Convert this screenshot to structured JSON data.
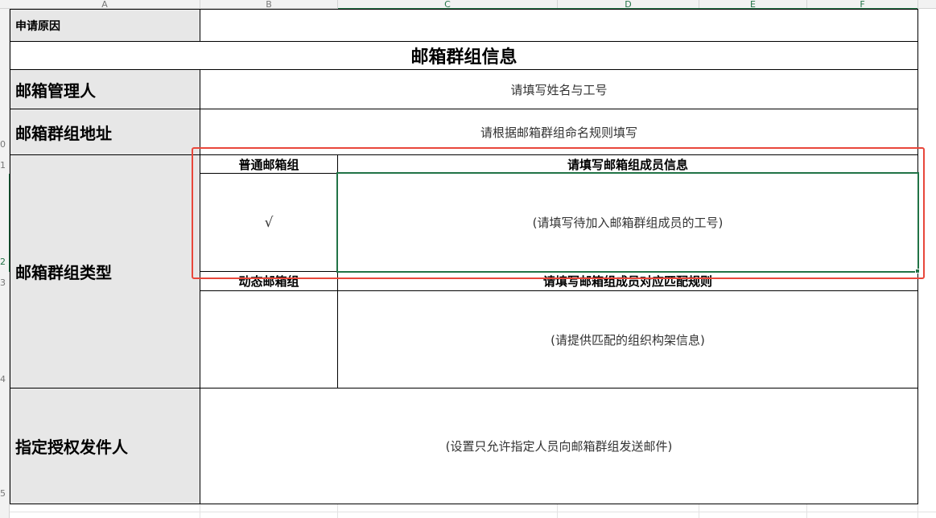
{
  "columns": [
    "A",
    "B",
    "C",
    "D",
    "E",
    "F"
  ],
  "rows": [
    "0",
    "1",
    "2",
    "3",
    "4",
    "5"
  ],
  "sheet": {
    "reason_label": "申请原因",
    "title": "邮箱群组信息",
    "manager_label": "邮箱管理人",
    "manager_hint": "请填写姓名与工号",
    "address_label": "邮箱群组地址",
    "address_hint": "请根据邮箱群组命名规则填写",
    "type_label": "邮箱群组类型",
    "normal_group_label": "普通邮箱组",
    "normal_members_header": "请填写邮箱组成员信息",
    "normal_checkmark": "√",
    "normal_members_hint": "(请填写待加入邮箱群组成员的工号)",
    "dynamic_group_label": "动态邮箱组",
    "dynamic_rules_header": "请填写邮箱组成员对应匹配规则",
    "dynamic_rules_hint": "(请提供匹配的组织构架信息)",
    "sender_label": "指定授权发件人",
    "sender_hint": "(设置只允许指定人员向邮箱群组发送邮件)"
  },
  "colors": {
    "selection": "#217346",
    "highlight": "#e8473b",
    "label_fill": "#e7e7e7"
  }
}
